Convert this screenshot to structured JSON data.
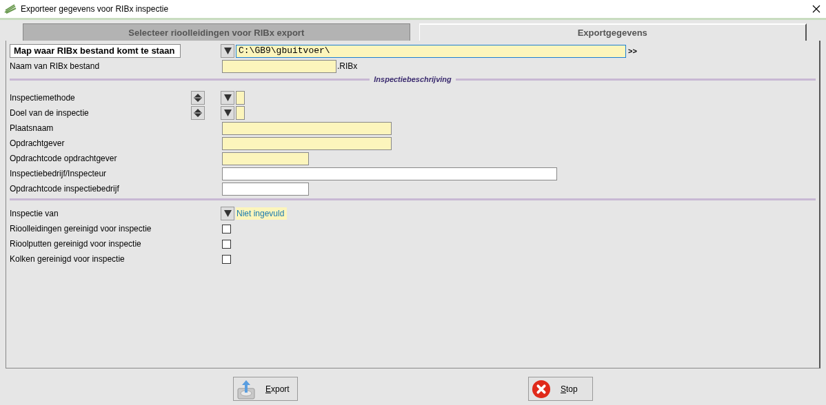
{
  "window": {
    "title": "Exporteer gegevens voor RIBx inspectie"
  },
  "tabs": [
    {
      "label": "Selecteer rioolleidingen voor RIBx export",
      "selected": false
    },
    {
      "label": "Exportgegevens",
      "selected": true
    }
  ],
  "folder": {
    "label": "Map waar RIBx bestand komt te staan",
    "value": "C:\\GB9\\gbuitvoer\\",
    "browse": ">>"
  },
  "file": {
    "label": "Naam van RIBx bestand",
    "suffix": ".RIBx"
  },
  "section": {
    "title": "Inspectiebeschrijving"
  },
  "groups": [
    [
      {
        "kind": "spin_dropdown",
        "label": "Inspectiemethode",
        "required": true
      },
      {
        "kind": "spin_dropdown",
        "label": "Doel van de inspectie",
        "required": true
      },
      {
        "kind": "field",
        "label": "Plaatsnaam",
        "required": true
      },
      {
        "kind": "field",
        "label": "Opdrachtgever",
        "required": true
      },
      {
        "kind": "field",
        "label": "Opdrachtcode opdrachtgever",
        "required": true
      },
      {
        "kind": "field",
        "label": "Inspectiebedrijf/Inspecteur",
        "required": false
      },
      {
        "kind": "field",
        "label": "Opdrachtcode inspectiebedrijf",
        "required": false
      }
    ],
    [
      {
        "kind": "dropdown",
        "label": "Inspectie van",
        "value": "Niet ingevuld"
      },
      {
        "kind": "checkbox",
        "label": "Rioolleidingen gereinigd voor inspectie",
        "checked": false
      },
      {
        "kind": "checkbox",
        "label": "Rioolputten gereinigd voor inspectie",
        "checked": false
      },
      {
        "kind": "checkbox",
        "label": "Kolken gereinigd voor inspectie",
        "checked": false
      }
    ]
  ],
  "buttons": [
    {
      "kind": "export",
      "label": "Export"
    },
    {
      "kind": "stop",
      "label": "Stop"
    }
  ]
}
